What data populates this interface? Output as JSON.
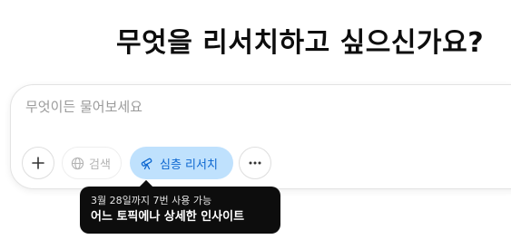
{
  "heading": "무엇을 리서치하고 싶으신가요?",
  "composer": {
    "placeholder": "무엇이든 물어보세요",
    "value": ""
  },
  "toolbar": {
    "search_label": "검색",
    "deep_research_label": "심층 리서치"
  },
  "tooltip": {
    "limit_text": "3월 28일까지 7번 사용 가능",
    "description": "어느 토픽에나 상세한 인사이트"
  },
  "icons": {
    "plus": "plus-icon",
    "search": "globe-icon",
    "deep_research": "telescope-icon",
    "more": "ellipsis-icon"
  },
  "colors": {
    "deep_research_bg": "#bfe1fd",
    "deep_research_text": "#0d67d0",
    "tooltip_bg": "#0d0d0d",
    "placeholder": "#9b9b9b"
  }
}
